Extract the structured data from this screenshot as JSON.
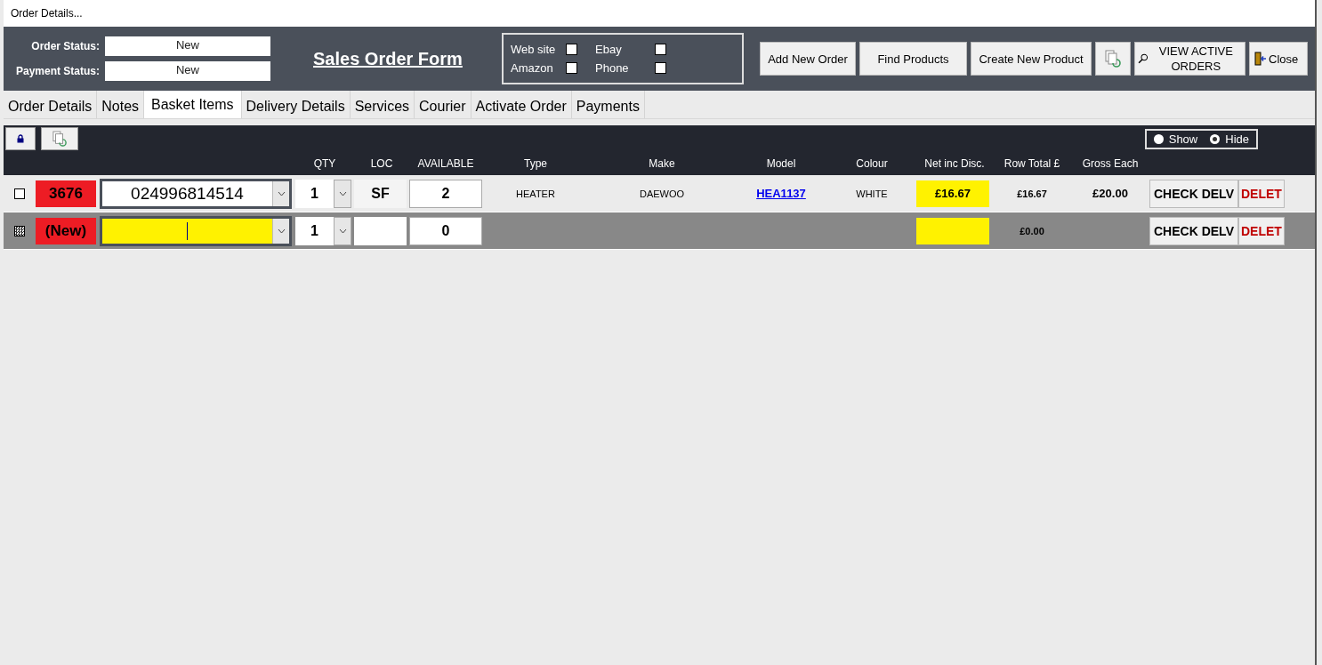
{
  "window": {
    "title": "Order Details..."
  },
  "header": {
    "order_status_label": "Order Status:",
    "order_status": "New",
    "payment_status_label": "Payment Status:",
    "payment_status": "New",
    "form_title": "Sales Order Form",
    "channels": [
      {
        "label": "Web site",
        "checked": false
      },
      {
        "label": "Ebay",
        "checked": false
      },
      {
        "label": "Amazon",
        "checked": false
      },
      {
        "label": "Phone",
        "checked": false
      }
    ],
    "buttons": [
      {
        "kind": "text",
        "label": "Add New Order"
      },
      {
        "kind": "text",
        "label": "Find Products"
      },
      {
        "kind": "text",
        "label": "Create New Product"
      },
      {
        "kind": "refresh"
      },
      {
        "kind": "search",
        "label": "VIEW ACTIVE ORDERS"
      },
      {
        "kind": "exit",
        "label": "Close"
      }
    ]
  },
  "tabs": [
    {
      "label": "Order Details",
      "selected": false
    },
    {
      "label": "Notes",
      "selected": false
    },
    {
      "label": "Basket Items",
      "selected": true
    },
    {
      "label": "Delivery Details",
      "selected": false
    },
    {
      "label": "Services",
      "selected": false
    },
    {
      "label": "Courier",
      "selected": false
    },
    {
      "label": "Activate Order",
      "selected": false
    },
    {
      "label": "Payments",
      "selected": false
    }
  ],
  "toggle": [
    {
      "label": "Show",
      "selected": false
    },
    {
      "label": "Hide",
      "selected": true
    }
  ],
  "table": {
    "columns": [
      "QTY",
      "LOC",
      "AVAILABLE",
      "Type",
      "Make",
      "Model",
      "Colour",
      "Net inc Disc.",
      "Row Total £",
      "Gross Each"
    ],
    "rows": [
      {
        "kind": "item",
        "id": "3676",
        "product": "024996814514",
        "qty": "1",
        "loc": "SF",
        "available": "2",
        "type": "HEATER",
        "make": "DAEWOO",
        "model": "HEA1137",
        "colour": "WHITE",
        "net": "£16.67",
        "row_total": "£16.67",
        "gross": "£20.00",
        "check": "CHECK DELV",
        "delete": "DELET"
      },
      {
        "kind": "new",
        "id": "(New)",
        "product": "",
        "qty": "1",
        "loc": "",
        "available": "0",
        "net": "",
        "row_total": "£0.00",
        "check": "CHECK DELV",
        "delete": "DELET"
      }
    ]
  }
}
